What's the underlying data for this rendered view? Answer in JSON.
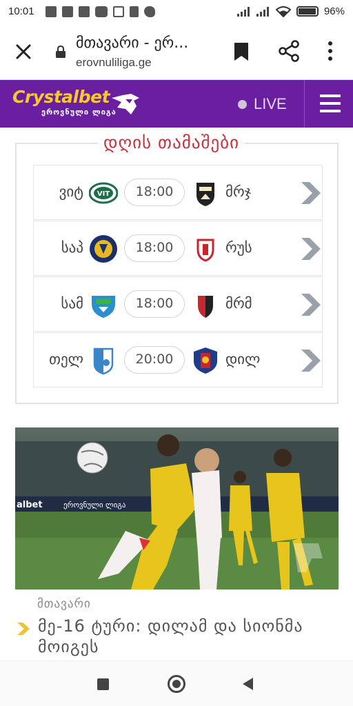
{
  "status_bar": {
    "time": "10:01",
    "battery": "96%",
    "battery_level": 0.96,
    "left_icons": [
      "facebook-icon",
      "facebook-icon",
      "facebook-icon",
      "youtube-icon",
      "qr-icon",
      "trash-icon",
      "twitter-icon"
    ],
    "right_icons": [
      "signal-icon",
      "signal-icon",
      "wifi-icon",
      "battery-icon"
    ]
  },
  "browser": {
    "title": "მთავარი - ერ...",
    "url": "erovnuliliga.ge"
  },
  "site_header": {
    "logo_main": "Crystalbet",
    "logo_sub": "ეროვნული ლიგა",
    "live_label": "LIVE",
    "colors": {
      "background": "#6a1fa0",
      "logo": "#f7c831"
    }
  },
  "matches": {
    "title": "დღის თამაშები",
    "title_color": "#c8323c",
    "rows": [
      {
        "home": "ვიტ",
        "time": "18:00",
        "away": "მრჯ",
        "home_crest": "vit-crest-icon",
        "away_crest": "mrj-crest-icon"
      },
      {
        "home": "საპ",
        "time": "18:00",
        "away": "რუს",
        "home_crest": "sap-crest-icon",
        "away_crest": "rus-crest-icon"
      },
      {
        "home": "სამ",
        "time": "18:00",
        "away": "მრმ",
        "home_crest": "sam-crest-icon",
        "away_crest": "mrm-crest-icon"
      },
      {
        "home": "თელ",
        "time": "20:00",
        "away": "დილ",
        "home_crest": "tel-crest-icon",
        "away_crest": "dil-crest-icon"
      }
    ]
  },
  "news": {
    "category": "მთავარი",
    "headline": "მე-16 ტური: დილამ და სიონმა მოიგეს",
    "photo_banner_text": "ეროვნული ლიგა",
    "photo_banner_brand": "albet"
  }
}
